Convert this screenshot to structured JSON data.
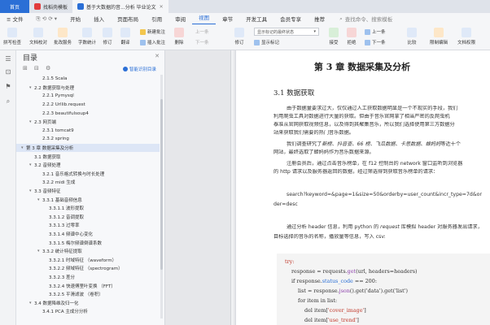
{
  "tabs": [
    {
      "label": "首页",
      "name": "tab-home"
    },
    {
      "label": "找稻壳模板",
      "name": "tab-template"
    },
    {
      "label": "基于大数据的音...分析 毕业论文",
      "name": "tab-document"
    }
  ],
  "menu": {
    "file": "文件",
    "items": [
      "开始",
      "插入",
      "页面布局",
      "引用",
      "审阅",
      "视图",
      "章节",
      "开发工具",
      "会员专享",
      "推荐"
    ],
    "selected": "视图",
    "search_placeholder": "查找命令、搜索模板"
  },
  "ribbon": {
    "buttons": [
      "拼写检查",
      "文档校对",
      "批改服务",
      "字数统计",
      "修订",
      "翻译",
      "删除",
      "修订",
      "修订",
      "下一条",
      "比较",
      "限制编辑",
      "文档权限"
    ],
    "small": {
      "new_comment": "新建批注",
      "prev": "上一条",
      "next": "下一条",
      "insert_comment": "插入批注",
      "show_markup": "显示标记",
      "accept": "接受",
      "reject": "拒绝",
      "prev2": "上一条",
      "next2": "下一条"
    },
    "combo_value": "显示标记的最终状态",
    "show_label": "显示标记"
  },
  "toc": {
    "title": "目录",
    "smart_label": "智能识别目录",
    "items": [
      {
        "level": 3,
        "text": "2.1.5 Scala"
      },
      {
        "level": 2,
        "text": "2.2 数据获取与处理",
        "caret": "▾"
      },
      {
        "level": 3,
        "text": "2.2.1 Pymysql"
      },
      {
        "level": 3,
        "text": "2.2.2 Urllib.request"
      },
      {
        "level": 3,
        "text": "2.2.3 beautifulsoup4"
      },
      {
        "level": 2,
        "text": "2.3 网页端",
        "caret": "▾"
      },
      {
        "level": 3,
        "text": "2.3.1 tomcat9"
      },
      {
        "level": 3,
        "text": "2.3.2 spring"
      },
      {
        "level": 1,
        "text": "第 3 章 数据采集及分析",
        "caret": "▾",
        "selected": true
      },
      {
        "level": 2,
        "text": "3.1 数据获取"
      },
      {
        "level": 2,
        "text": "3.2 音频处理",
        "caret": "▾"
      },
      {
        "level": 3,
        "text": "3.2.1 音乐格式转换与时长处理"
      },
      {
        "level": 3,
        "text": "3.2.2 midi 生成"
      },
      {
        "level": 2,
        "text": "3.3 音频特征",
        "caret": "▾"
      },
      {
        "level": 3,
        "text": "3.3.1 基础音频信息",
        "caret": "▾"
      },
      {
        "level": 4,
        "text": "3.3.1.1 波形提取"
      },
      {
        "level": 4,
        "text": "3.3.1.2 音调提取"
      },
      {
        "level": 4,
        "text": "3.3.1.3 过零率"
      },
      {
        "level": 4,
        "text": "3.3.1.4 频谱中心变化"
      },
      {
        "level": 4,
        "text": "3.3.1.5 梅尔频谱倒谱系数"
      },
      {
        "level": 3,
        "text": "3.3.2 统计特征提取",
        "caret": "▾"
      },
      {
        "level": 4,
        "text": "3.3.2.1 时域特征 （waveform）"
      },
      {
        "level": 4,
        "text": "3.3.2.2 频域特征 （spectrogram）"
      },
      {
        "level": 4,
        "text": "3.3.2.3 差分"
      },
      {
        "level": 4,
        "text": "3.3.2.4 快速傅里叶变换 （FFT）"
      },
      {
        "level": 4,
        "text": "3.3.2.5 平滑滤波 （卷积）"
      },
      {
        "level": 2,
        "text": "3.4 数据降维及归一化",
        "caret": "▾"
      },
      {
        "level": 3,
        "text": "3.4.1 PCA 主成分分析"
      }
    ]
  },
  "doc": {
    "chapter_title": "第 3 章 数据采集及分析",
    "section_title": "3.1  数据获取",
    "p1_l1": "由于数据量要求过大，仅仅通过人工获取数据明显是一个不现实的手段，我们",
    "p1_l2": "利用爬虫工具对数据进行大量的获取。但由于音乐官网拿了相当严密的反爬虫机",
    "p1_l3": "泰准从官网获取视频信息，以及得到其聚集音乐，所以我们选择使用第三方数据分",
    "p1_l4": "站来获取我们需要的热门音乐数据。",
    "p2_l1_a": "我们调查研究了",
    "p2_l1_em": "新榜、抖音查、66 榜、飞瓜数据、卡思数据、蝉妈妈",
    "p2_l1_b": "等近十个",
    "p2_l2": "网站，最终选取了蝉妈妈作为音乐数据来源。",
    "p3_l1": "注册会员后，通过点击音乐榜单，在 f12 控制台的 network 窗口监听到浏览器",
    "p3_l2": "的 http 请求以及服务器返回的数据，经过筛选得到获取音乐榜单的请求：",
    "url_l1": "search?keyword=&page=1&size=50&orderby=user_count&incr_type=7d&or",
    "url_l2": "der=desc",
    "p4_l1_a": "通过分析 header 信息，利用 python 的 ",
    "p4_l1_em": "request",
    "p4_l1_b": " 库模拟 header 对服务器发出请求，",
    "p4_l2": "目标选择的音乐的名称，播放量等信息，写入 csv:",
    "code": {
      "l1": "try:",
      "l2_a": "response = requests.",
      "l2_fn": "get",
      "l2_b": "(url, headers=headers)",
      "l3_a": "if response.",
      "l3_at": "status_code",
      "l3_b": " == 200:",
      "l4_a": "list = response.",
      "l4_fn": "json",
      "l4_b": "().get('data').get('list')",
      "l5": "for item in list:",
      "l6_a": "del item[",
      "l6_s": "'cover_image'",
      "l6_b": "]",
      "l7_a": "del item[",
      "l7_s": "'use_trend'",
      "l7_b": "]"
    }
  },
  "colors": {
    "accent": "#2b6fd6",
    "toc_selected": "#dde6f6",
    "keyword": "#c0392b"
  }
}
